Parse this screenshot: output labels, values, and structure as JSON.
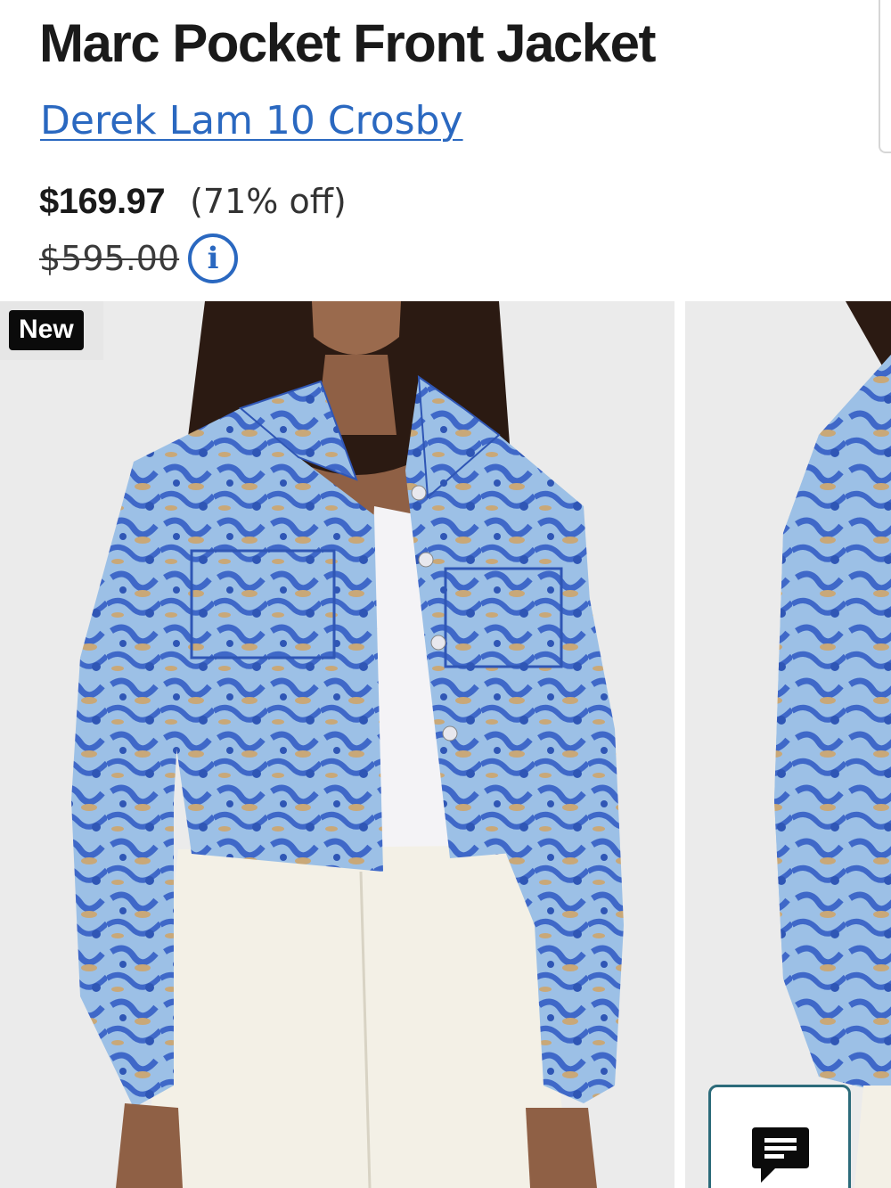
{
  "product": {
    "title": "Marc Pocket Front Jacket",
    "brand": "Derek Lam 10 Crosby",
    "sale_price": "$169.97",
    "discount": "(71% off)",
    "original_price": "$595.00"
  },
  "gallery": {
    "badge": "New",
    "images": [
      {
        "alt": "model wearing blue floral cropped jacket, front view"
      },
      {
        "alt": "model wearing blue floral cropped jacket, side view"
      }
    ]
  },
  "icons": {
    "info": "info-icon",
    "chat": "chat-icon"
  },
  "colors": {
    "brand_link": "#2a68c0",
    "badge_bg": "#0b0b0b",
    "jacket_light": "#9cc0e6",
    "jacket_dark": "#3f68c8",
    "jacket_accent": "#c9a878",
    "chat_border": "#2c6b7a"
  }
}
